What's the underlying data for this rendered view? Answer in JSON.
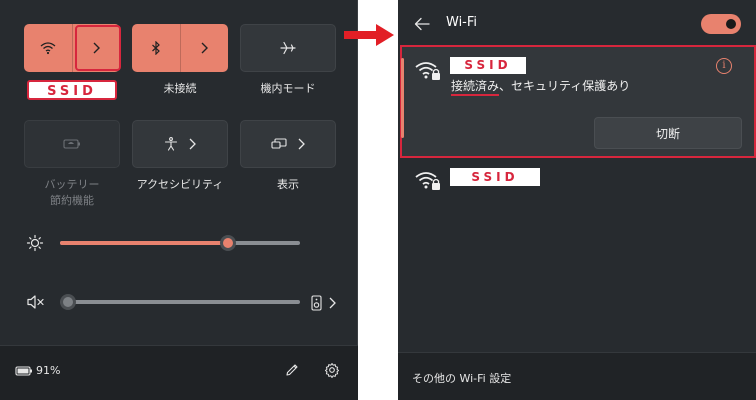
{
  "quick_settings": {
    "tiles": [
      {
        "id": "wifi",
        "label": "SSID",
        "state": "on"
      },
      {
        "id": "bluetooth",
        "label": "未接続",
        "state": "on"
      },
      {
        "id": "airplane",
        "label": "機内モード",
        "state": "off"
      },
      {
        "id": "battery_saver",
        "label_line1": "バッテリー",
        "label_line2": "節約機能",
        "state": "disabled"
      },
      {
        "id": "accessibility",
        "label": "アクセシビリティ",
        "state": "off"
      },
      {
        "id": "display",
        "label": "表示",
        "state": "off"
      }
    ],
    "brightness": {
      "value": 0.7
    },
    "volume": {
      "value": 0.0,
      "muted": true
    },
    "battery_percent": "91%"
  },
  "wifi_panel": {
    "title": "Wi-Fi",
    "toggle_on": true,
    "connected_network": {
      "ssid": "SSID",
      "status": "接続済み、セキュリティ保護あり",
      "status_underlined": "接続済み",
      "status_rest": "、セキュリティ保護あり",
      "disconnect_label": "切断"
    },
    "other_network": {
      "ssid": "SSID"
    },
    "footer_link": "その他の Wi-Fi 設定"
  },
  "colors": {
    "accent": "#e8826e",
    "highlight": "#d7263d",
    "panel_bg": "#272b2f"
  }
}
